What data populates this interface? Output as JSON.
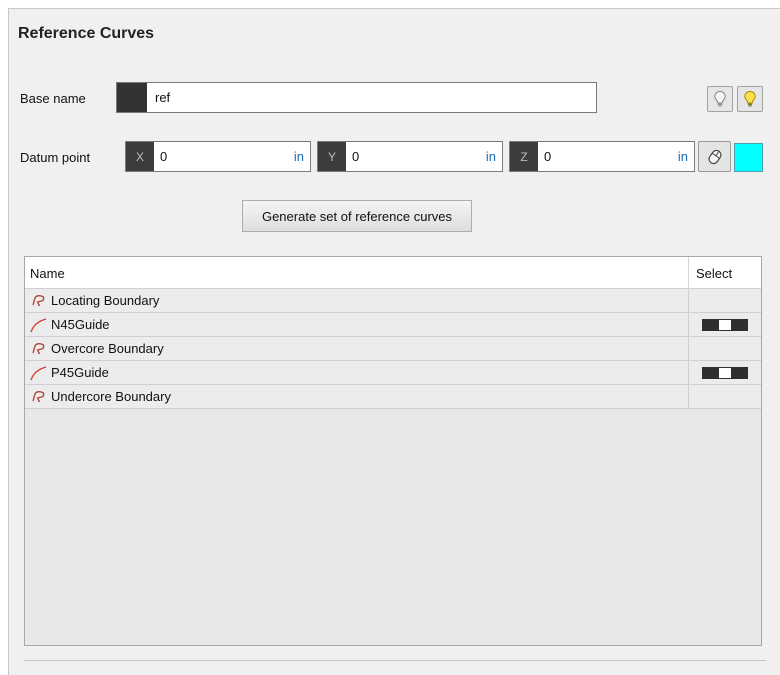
{
  "panel": {
    "title": "Reference Curves"
  },
  "base_name": {
    "label": "Base name",
    "value": "ref"
  },
  "datum_point": {
    "label": "Datum point",
    "x": {
      "axis": "X",
      "value": "0",
      "unit": "in"
    },
    "y": {
      "axis": "Y",
      "value": "0",
      "unit": "in"
    },
    "z": {
      "axis": "Z",
      "value": "0",
      "unit": "in"
    },
    "color": "#00ffff"
  },
  "actions": {
    "generate_label": "Generate set of reference curves"
  },
  "table": {
    "columns": {
      "name": "Name",
      "select": "Select"
    },
    "rows": [
      {
        "name": "Locating Boundary",
        "icon": "boundary-icon",
        "has_toggle": false
      },
      {
        "name": "N45Guide",
        "icon": "curve-icon",
        "has_toggle": true
      },
      {
        "name": "Overcore Boundary",
        "icon": "boundary-icon",
        "has_toggle": false
      },
      {
        "name": "P45Guide",
        "icon": "curve-icon",
        "has_toggle": true
      },
      {
        "name": "Undercore Boundary",
        "icon": "boundary-icon",
        "has_toggle": false
      }
    ]
  }
}
